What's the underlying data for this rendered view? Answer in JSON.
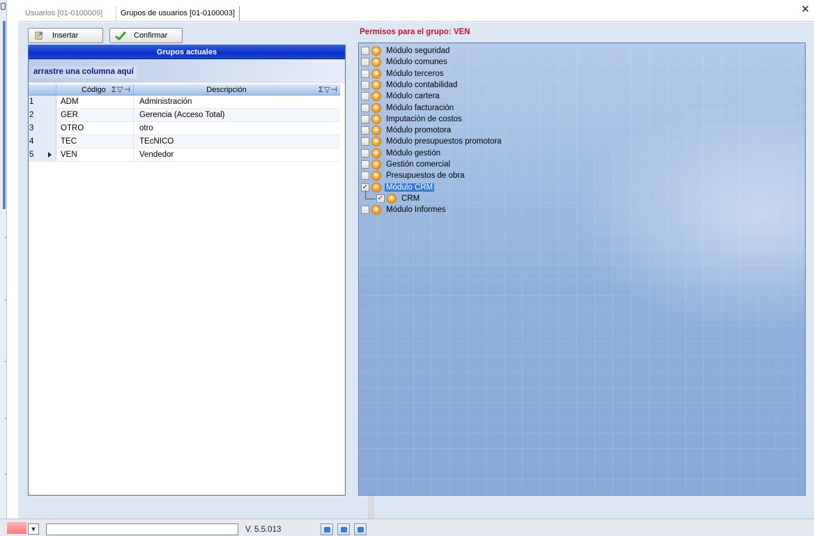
{
  "tabs": [
    {
      "label": "Usuarios [01-0100009]",
      "active": false
    },
    {
      "label": "Grupos de usuarios [01-0100003]",
      "active": true
    }
  ],
  "close_icon": "close-icon",
  "toolbar": {
    "insert_label": "Insertar",
    "confirm_label": "Confirmar"
  },
  "groups": {
    "title": "Grupos actuales",
    "groupby_hint": "arrastre una columna aquí",
    "columns": {
      "code": "Código",
      "description": "Descripción"
    },
    "rows": [
      {
        "n": "1",
        "code": "ADM",
        "description": "Administración",
        "current": false
      },
      {
        "n": "2",
        "code": "GER",
        "description": "Gerencia (Acceso Total)",
        "current": false
      },
      {
        "n": "3",
        "code": "OTRO",
        "description": "otro",
        "current": false
      },
      {
        "n": "4",
        "code": "TEC",
        "description": "TEcNICO",
        "current": false
      },
      {
        "n": "5",
        "code": "VEN",
        "description": "Vendedor",
        "current": true
      }
    ]
  },
  "permissions": {
    "title": "Permisos para el grupo: VEN",
    "items": [
      {
        "label": "Módulo seguridad",
        "checked": false,
        "expanded": false,
        "level": 0
      },
      {
        "label": "Módulo comunes",
        "checked": false,
        "expanded": false,
        "level": 0
      },
      {
        "label": "Módulo terceros",
        "checked": false,
        "expanded": false,
        "level": 0
      },
      {
        "label": "Módulo contabilidad",
        "checked": false,
        "expanded": false,
        "level": 0
      },
      {
        "label": "Módulo cartera",
        "checked": false,
        "expanded": false,
        "level": 0
      },
      {
        "label": "Módulo facturación",
        "checked": false,
        "expanded": false,
        "level": 0
      },
      {
        "label": "Imputación de costos",
        "checked": false,
        "expanded": false,
        "level": 0
      },
      {
        "label": "Módulo promotora",
        "checked": false,
        "expanded": false,
        "level": 0
      },
      {
        "label": "Módulo presupuestos promotora",
        "checked": false,
        "expanded": false,
        "level": 0
      },
      {
        "label": "Módulo gestión",
        "checked": false,
        "expanded": false,
        "level": 0
      },
      {
        "label": "Gestión comercial",
        "checked": false,
        "expanded": false,
        "level": 0
      },
      {
        "label": "Presupuestos de obra",
        "checked": false,
        "expanded": false,
        "level": 0
      },
      {
        "label": "Módulo CRM",
        "checked": true,
        "expanded": true,
        "level": 0,
        "selected": true
      },
      {
        "label": "CRM",
        "checked": true,
        "expanded": false,
        "level": 1
      },
      {
        "label": "Módulo Informes",
        "checked": false,
        "expanded": false,
        "level": 0
      }
    ]
  },
  "status": {
    "version": "V. 5.5.013"
  },
  "colors": {
    "title_bar": "#0b2fc4",
    "perm_title": "#c8102e",
    "selected": "#3a7bd5",
    "node_icon": "#f29a18"
  }
}
